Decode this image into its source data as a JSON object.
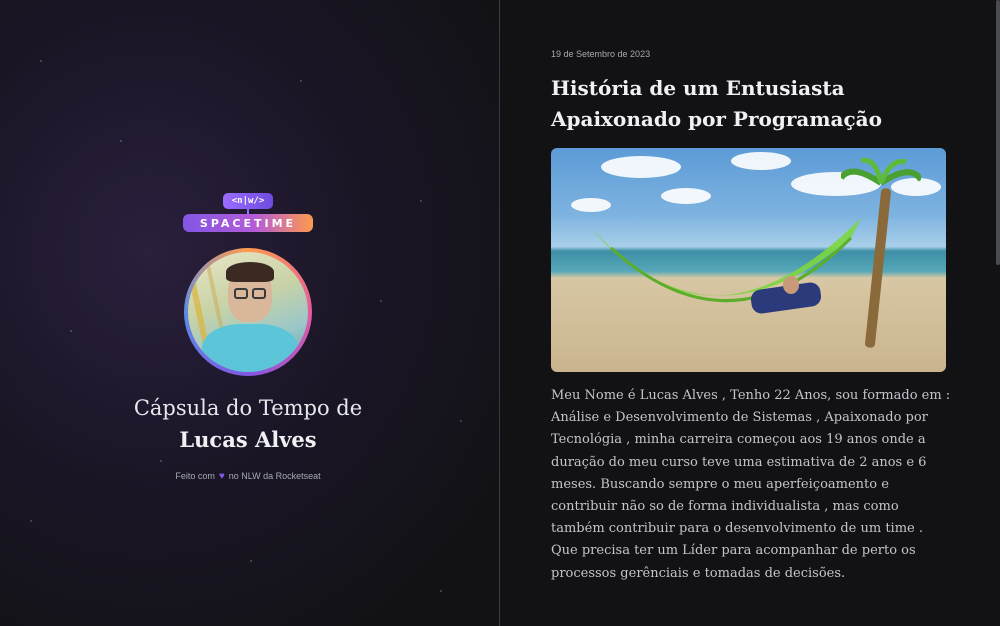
{
  "capsule": {
    "logo_tag": "<n|w/>",
    "logo_word": "SPACETIME",
    "title_prefix": "Cápsula do Tempo de",
    "owner_name": "Lucas Alves",
    "made_with_prefix": "Feito com",
    "made_with_suffix": "no NLW da Rocketseat",
    "heart_icon": "purple-heart-icon"
  },
  "memory": {
    "date": "19 de Setembro de 2023",
    "title": "História de um Entusiasta Apaixonado por Programação",
    "body": "Meu Nome é Lucas Alves , Tenho 22 Anos, sou formado em : Análise e Desenvolvimento de Sistemas , Apaixonado por Tecnológia , minha carreira começou aos 19 anos onde a duração do meu curso teve uma estimativa de 2 anos e 6 meses. Buscando sempre o meu aperfeiçoamento e contribuir não so de forma individualista , mas como também contribuir para o desenvolvimento de um time . Que precisa ter um Líder para acompanhar de perto os processos gerênciais e tomadas de decisões."
  },
  "colors": {
    "brand_purple": "#8257e5",
    "brand_orange": "#ff9a4d",
    "background": "#121215"
  }
}
